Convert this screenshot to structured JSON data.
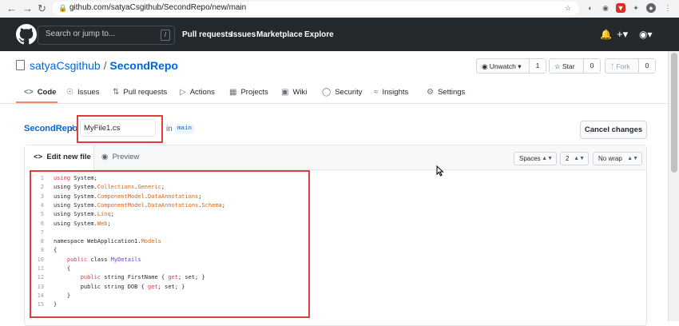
{
  "browser": {
    "url": "github.com/satyaCsgithub/SecondRepo/new/main"
  },
  "header": {
    "search_placeholder": "Search or jump to...",
    "search_shortcut": "/",
    "nav": [
      "Pull requests",
      "Issues",
      "Marketplace",
      "Explore"
    ]
  },
  "repo": {
    "owner": "satyaCsgithub",
    "separator": "/",
    "name": "SecondRepo",
    "unwatch_label": "Unwatch",
    "unwatch_count": "1",
    "star_label": "Star",
    "star_count": "0",
    "fork_label": "Fork",
    "fork_count": "0"
  },
  "tabs": [
    "Code",
    "Issues",
    "Pull requests",
    "Actions",
    "Projects",
    "Wiki",
    "Security",
    "Insights",
    "Settings"
  ],
  "file": {
    "breadcrumb_root": "SecondRepo",
    "breadcrumb_sep": "/",
    "filename": "MyFile1.cs",
    "in_label": "in",
    "branch": "main",
    "cancel_label": "Cancel changes"
  },
  "editor": {
    "tab_edit": "Edit new file",
    "tab_preview": "Preview",
    "indent_mode": "Spaces",
    "indent_size": "2",
    "wrap_mode": "No wrap"
  },
  "code": [
    {
      "n": "1",
      "parts": [
        [
          "kw",
          "using"
        ],
        [
          "",
          " System;"
        ]
      ]
    },
    {
      "n": "2",
      "parts": [
        [
          "",
          "using System."
        ],
        [
          "hi",
          "Collections"
        ],
        [
          "",
          "."
        ],
        [
          "hi",
          "Generic"
        ],
        [
          "",
          ";"
        ]
      ]
    },
    {
      "n": "3",
      "parts": [
        [
          "",
          "using System."
        ],
        [
          "hi",
          "ComponentModel"
        ],
        [
          "",
          "."
        ],
        [
          "hi",
          "DataAnnotations"
        ],
        [
          "",
          ";"
        ]
      ]
    },
    {
      "n": "4",
      "parts": [
        [
          "",
          "using System."
        ],
        [
          "hi",
          "ComponentModel"
        ],
        [
          "",
          "."
        ],
        [
          "hi",
          "DataAnnotations"
        ],
        [
          "",
          "."
        ],
        [
          "hi",
          "Schema"
        ],
        [
          "",
          ";"
        ]
      ]
    },
    {
      "n": "5",
      "parts": [
        [
          "",
          "using System."
        ],
        [
          "hi",
          "Linq"
        ],
        [
          "",
          ";"
        ]
      ]
    },
    {
      "n": "6",
      "parts": [
        [
          "",
          "using System."
        ],
        [
          "hi",
          "Web"
        ],
        [
          "",
          ";"
        ]
      ]
    },
    {
      "n": "7",
      "parts": []
    },
    {
      "n": "8",
      "parts": [
        [
          "",
          "namespace WebApplication1."
        ],
        [
          "hi",
          "Models"
        ]
      ]
    },
    {
      "n": "9",
      "parts": [
        [
          "",
          "{"
        ]
      ]
    },
    {
      "n": "10",
      "parts": [
        [
          "",
          "    "
        ],
        [
          "kw",
          "public"
        ],
        [
          "",
          " class "
        ],
        [
          "ty",
          "MyDetails"
        ]
      ]
    },
    {
      "n": "11",
      "parts": [
        [
          "",
          "    {"
        ]
      ]
    },
    {
      "n": "12",
      "parts": [
        [
          "",
          "        "
        ],
        [
          "kw",
          "public"
        ],
        [
          "",
          " string FirstName { "
        ],
        [
          "kw",
          "get"
        ],
        [
          "",
          "; set; }"
        ]
      ]
    },
    {
      "n": "13",
      "parts": [
        [
          "",
          "        public string DOB { "
        ],
        [
          "kw",
          "get"
        ],
        [
          "",
          "; set; }"
        ]
      ]
    },
    {
      "n": "14",
      "parts": [
        [
          "",
          "    }"
        ]
      ]
    },
    {
      "n": "15",
      "parts": [
        [
          "",
          "}"
        ]
      ]
    }
  ],
  "colors": {
    "header_bg": "#24292e",
    "link": "#0366d6",
    "tab_accent": "#f9826c",
    "highlight_box": "#e03e3e"
  }
}
